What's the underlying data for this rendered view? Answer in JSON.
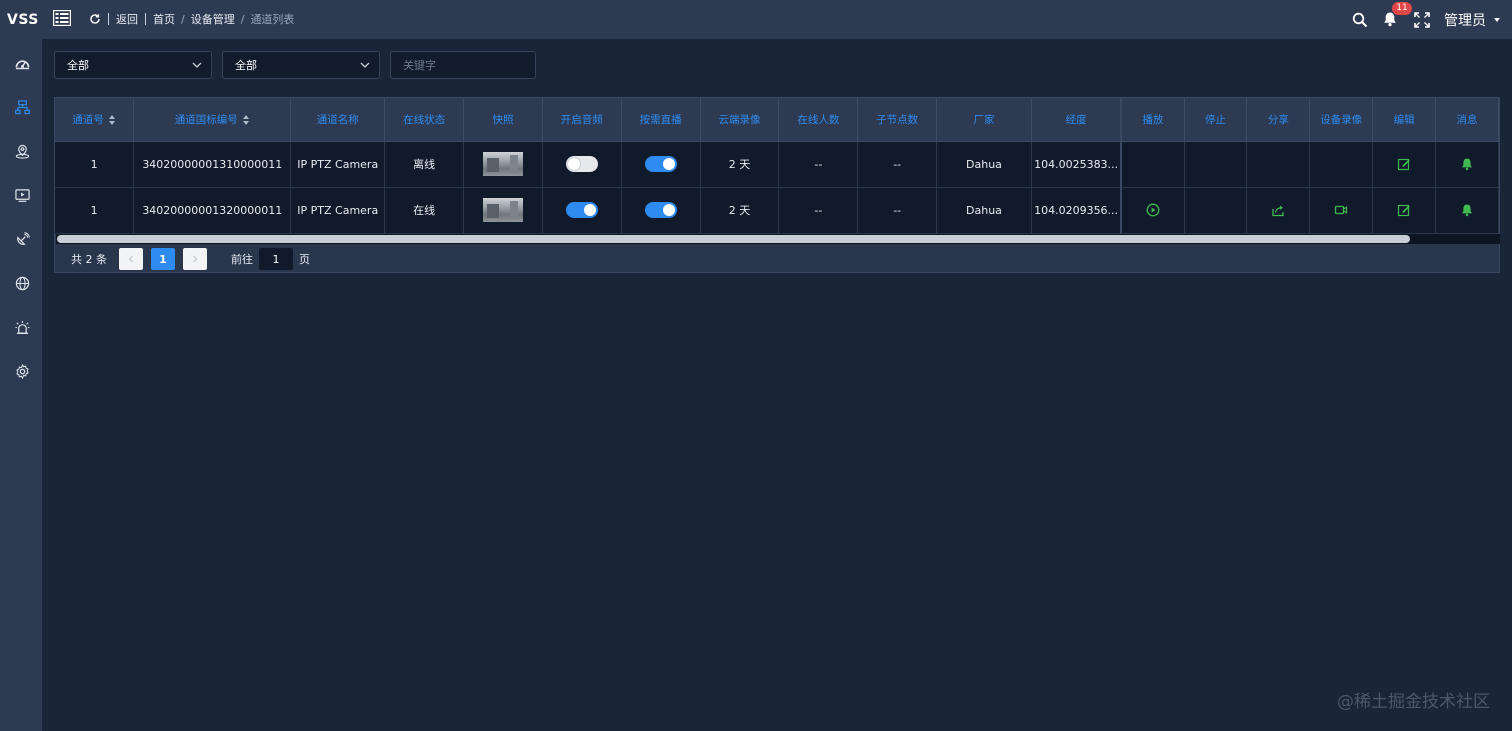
{
  "app": {
    "logo": "VSS"
  },
  "breadcrumb": {
    "back": "返回",
    "home": "首页",
    "section": "设备管理",
    "current": "通道列表"
  },
  "header": {
    "notifications_count": "11",
    "user": "管理员"
  },
  "sidebar": {
    "items": [
      {
        "icon": "dashboard-icon"
      },
      {
        "icon": "device-tree-icon",
        "active": true
      },
      {
        "icon": "map-pin-icon"
      },
      {
        "icon": "video-player-icon"
      },
      {
        "icon": "satellite-icon"
      },
      {
        "icon": "globe-icon"
      },
      {
        "icon": "alarm-icon"
      },
      {
        "icon": "settings-icon"
      }
    ]
  },
  "filters": {
    "type_select": "全部",
    "status_select": "全部",
    "keyword_placeholder": "关键字"
  },
  "table": {
    "columns": [
      "通道号",
      "通道国标编号",
      "通道名称",
      "在线状态",
      "快照",
      "开启音频",
      "按需直播",
      "云端录像",
      "在线人数",
      "子节点数",
      "厂家",
      "经度",
      "播放",
      "停止",
      "分享",
      "设备录像",
      "编辑",
      "消息"
    ],
    "rows": [
      {
        "no": "1",
        "gb_id": "34020000001310000011",
        "name": "IP PTZ Camera",
        "status": "离线",
        "audio": false,
        "on_demand": true,
        "cloud": "2 天",
        "viewers": "--",
        "children": "--",
        "vendor": "Dahua",
        "lng": "104.0025383...",
        "actions": {
          "play": false,
          "share": false,
          "record": false
        }
      },
      {
        "no": "1",
        "gb_id": "34020000001320000011",
        "name": "IP PTZ Camera",
        "status": "在线",
        "audio": true,
        "on_demand": true,
        "cloud": "2 天",
        "viewers": "--",
        "children": "--",
        "vendor": "Dahua",
        "lng": "104.0209356...",
        "actions": {
          "play": true,
          "share": true,
          "record": true
        }
      }
    ]
  },
  "pagination": {
    "total": "共 2 条",
    "current_page": "1",
    "goto_label": "前往",
    "goto_value": "1",
    "page_unit": "页"
  },
  "colors": {
    "accent": "#2e8cf0",
    "action_green": "#3fb950",
    "bg": "#1b2538",
    "panel": "#2d3a52"
  },
  "watermark": "@稀土掘金技术社区"
}
